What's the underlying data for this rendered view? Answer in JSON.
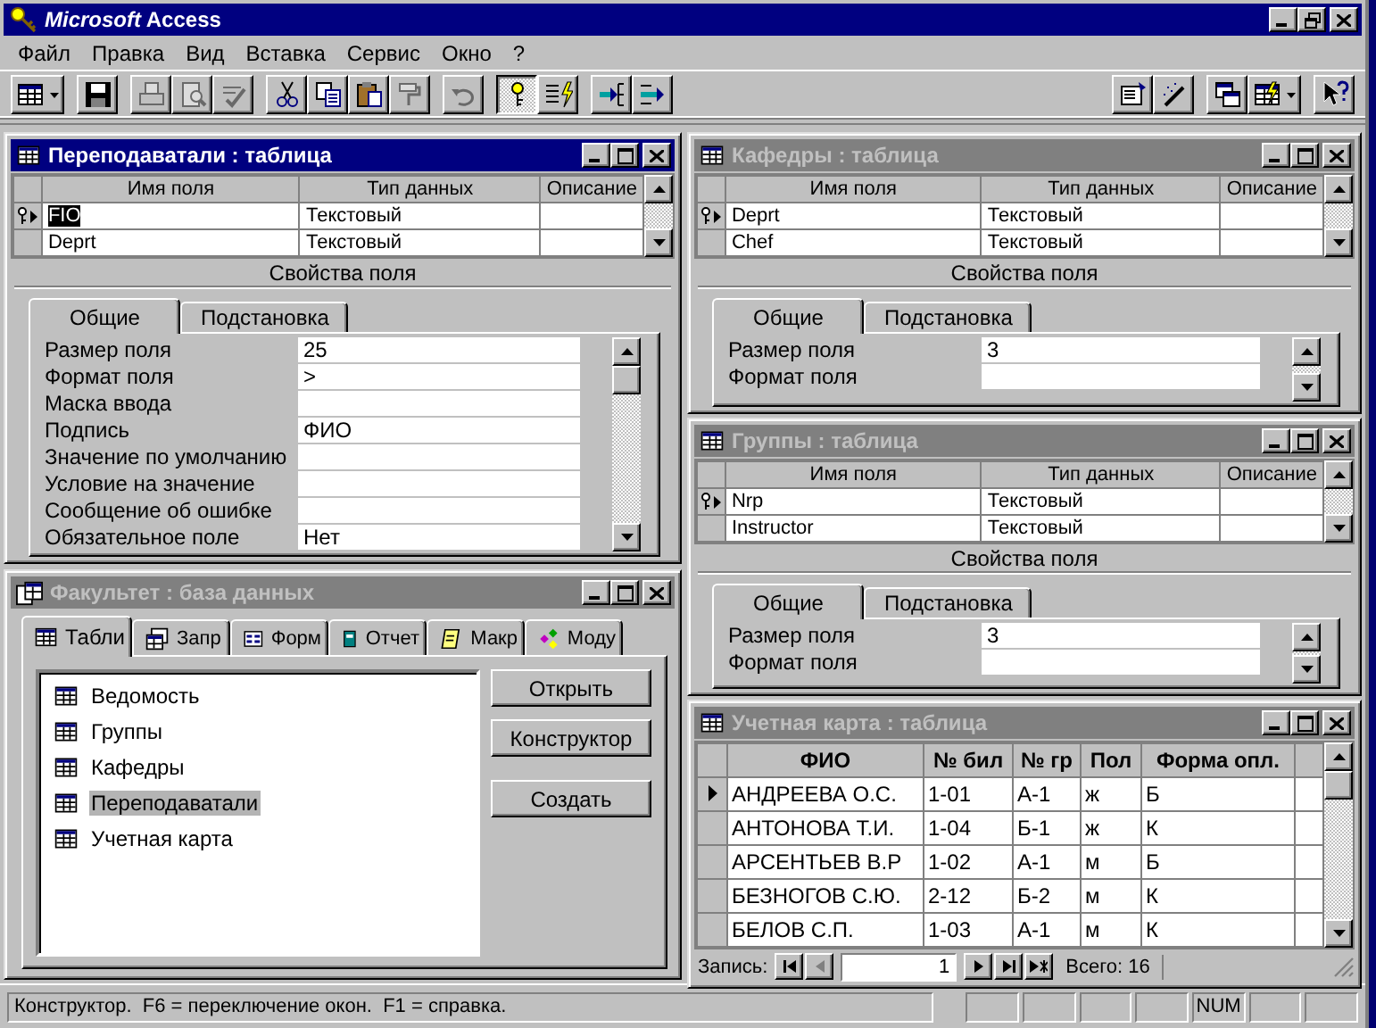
{
  "app": {
    "title": "*Microsoft* Access"
  },
  "menu": [
    "Файл",
    "Правка",
    "Вид",
    "Вставка",
    "Сервис",
    "Окно",
    "?"
  ],
  "toolbar": [
    {
      "disabled": false,
      "pressed": false
    },
    {
      "disabled": false,
      "pressed": false
    },
    {
      "disabled": true,
      "pressed": false
    },
    {
      "disabled": true,
      "pressed": false
    },
    {
      "disabled": true,
      "pressed": false
    },
    {
      "disabled": false,
      "pressed": false
    },
    {
      "disabled": false,
      "pressed": false
    },
    {
      "disabled": false,
      "pressed": false
    },
    {
      "disabled": true,
      "pressed": false
    },
    {
      "disabled": true,
      "pressed": false
    },
    {
      "disabled": false,
      "pressed": true
    },
    {
      "disabled": false,
      "pressed": false
    },
    {
      "disabled": false,
      "pressed": false
    },
    {
      "disabled": false,
      "pressed": false
    },
    {
      "disabled": false,
      "pressed": false
    },
    {
      "disabled": false,
      "pressed": false
    },
    {
      "disabled": false,
      "pressed": false
    },
    {
      "disabled": false,
      "pressed": false
    },
    {
      "disabled": false,
      "pressed": false
    }
  ],
  "design_windows": [
    {
      "title": "Переподаватали : таблица",
      "active": true,
      "columns": [
        "Имя поля",
        "Тип данных",
        "Описание"
      ],
      "fields": [
        {
          "name": "FIO",
          "type": "Текстовый",
          "primary_key": true,
          "current": true,
          "highlighted": true
        },
        {
          "name": "Deprt",
          "type": "Текстовый",
          "primary_key": false,
          "current": false,
          "highlighted": false
        }
      ],
      "properties_label": "Свойства поля",
      "tabs": [
        {
          "label": "Общие",
          "selected": true
        },
        {
          "label": "Подстановка",
          "selected": false
        }
      ],
      "properties": [
        {
          "label": "Размер поля",
          "value": "25"
        },
        {
          "label": "Формат поля",
          "value": ">"
        },
        {
          "label": "Маска ввода"
        },
        {
          "label": "Подпись",
          "value": "ФИО"
        },
        {
          "label": "Значение по умолчанию"
        },
        {
          "label": "Условие на значение"
        },
        {
          "label": "Сообщение об ошибке"
        },
        {
          "label": "Обязательное поле",
          "value": "Нет"
        }
      ]
    },
    {
      "title": "Кафедры : таблица",
      "active": false,
      "columns": [
        "Имя поля",
        "Тип данных",
        "Описание"
      ],
      "fields": [
        {
          "name": "Deprt",
          "type": "Текстовый",
          "primary_key": true,
          "current": true,
          "highlighted": false
        },
        {
          "name": "Chef",
          "type": "Текстовый",
          "primary_key": false,
          "current": false,
          "highlighted": false
        }
      ],
      "properties_label": "Свойства поля",
      "tabs": [
        {
          "label": "Общие",
          "selected": true
        },
        {
          "label": "Подстановка",
          "selected": false
        }
      ],
      "properties": [
        {
          "label": "Размер поля",
          "value": "3"
        },
        {
          "label": "Формат поля"
        }
      ]
    },
    {
      "title": "Группы : таблица",
      "active": false,
      "columns": [
        "Имя поля",
        "Тип данных",
        "Описание"
      ],
      "fields": [
        {
          "name": "Nrp",
          "type": "Текстовый",
          "primary_key": true,
          "current": true,
          "highlighted": false
        },
        {
          "name": "Instructor",
          "type": "Текстовый",
          "primary_key": false,
          "current": false,
          "highlighted": false
        }
      ],
      "properties_label": "Свойства поля",
      "tabs": [
        {
          "label": "Общие",
          "selected": true
        },
        {
          "label": "Подстановка",
          "selected": false
        }
      ],
      "properties": [
        {
          "label": "Размер поля",
          "value": "3"
        },
        {
          "label": "Формат поля"
        }
      ]
    }
  ],
  "database_window": {
    "title": "Факультет : база данных",
    "active": false,
    "tabs": [
      {
        "label": "Табли",
        "kind": "table",
        "selected": true
      },
      {
        "label": "Запр",
        "kind": "query",
        "selected": false
      },
      {
        "label": "Форм",
        "kind": "form",
        "selected": false
      },
      {
        "label": "Отчет",
        "kind": "report",
        "selected": false
      },
      {
        "label": "Макр",
        "kind": "macro",
        "selected": false
      },
      {
        "label": "Моду",
        "kind": "module",
        "selected": false
      }
    ],
    "items": [
      {
        "label": "Ведомость",
        "selected": false
      },
      {
        "label": "Группы",
        "selected": false
      },
      {
        "label": "Кафедры",
        "selected": false
      },
      {
        "label": "Переподаватали",
        "selected": true
      },
      {
        "label": "Учетная карта",
        "selected": false
      }
    ],
    "buttons": [
      "Открыть",
      "Конструктор",
      "Создать"
    ]
  },
  "datasheet_window": {
    "title": "Учетная карта : таблица",
    "active": false,
    "columns": [
      "ФИО",
      "№ бил",
      "№ гр",
      "Пол",
      "Форма опл."
    ],
    "rows": [
      {
        "current": true,
        "cells": [
          "АНДРЕЕВА О.С.",
          "1-01",
          "А-1",
          "ж",
          "Б"
        ]
      },
      {
        "current": false,
        "cells": [
          "АНТОНОВА Т.И.",
          "1-04",
          "Б-1",
          "ж",
          "К"
        ]
      },
      {
        "current": false,
        "cells": [
          "АРСЕНТЬЕВ В.Р",
          "1-02",
          "А-1",
          "м",
          "Б"
        ]
      },
      {
        "current": false,
        "cells": [
          "БЕЗНОГОВ С.Ю.",
          "2-12",
          "Б-2",
          "м",
          "К"
        ]
      },
      {
        "current": false,
        "cells": [
          "БЕЛОВ С.П.",
          "1-03",
          "А-1",
          "м",
          "К"
        ]
      }
    ],
    "navigator": {
      "label": "Запись:",
      "record": "1",
      "total": "Всего: 16"
    }
  },
  "status_bar": {
    "text": "Конструктор.  F6 = переключение окон.  F1 = справка.",
    "indicator": "NUM"
  }
}
